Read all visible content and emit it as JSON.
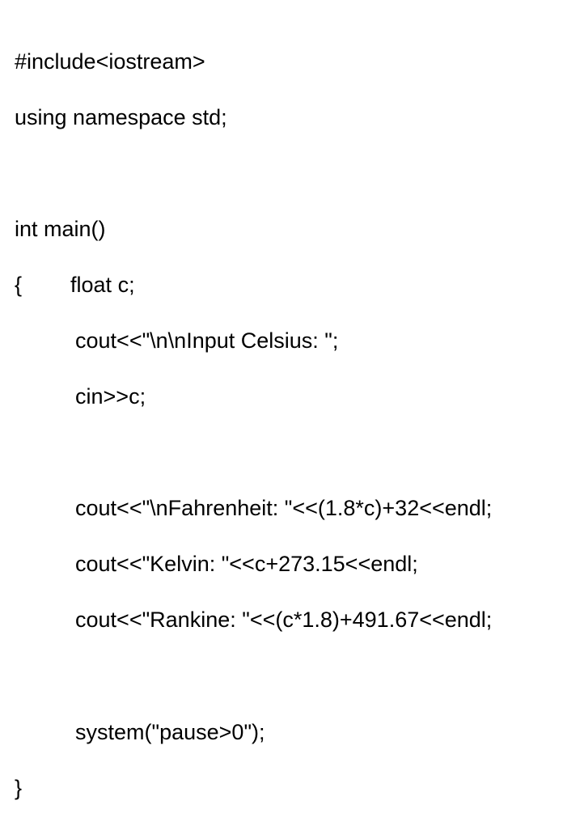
{
  "code": {
    "lines": [
      "#include<iostream>",
      "using namespace std;",
      "",
      "int main()",
      "{        float c;",
      "          cout<<\"\\n\\nInput Celsius: \";",
      "          cin>>c;",
      "",
      "          cout<<\"\\nFahrenheit: \"<<(1.8*c)+32<<endl;",
      "          cout<<\"Kelvin: \"<<c+273.15<<endl;",
      "          cout<<\"Rankine: \"<<(c*1.8)+491.67<<endl;",
      "",
      "          system(\"pause>0\");",
      "}"
    ]
  }
}
